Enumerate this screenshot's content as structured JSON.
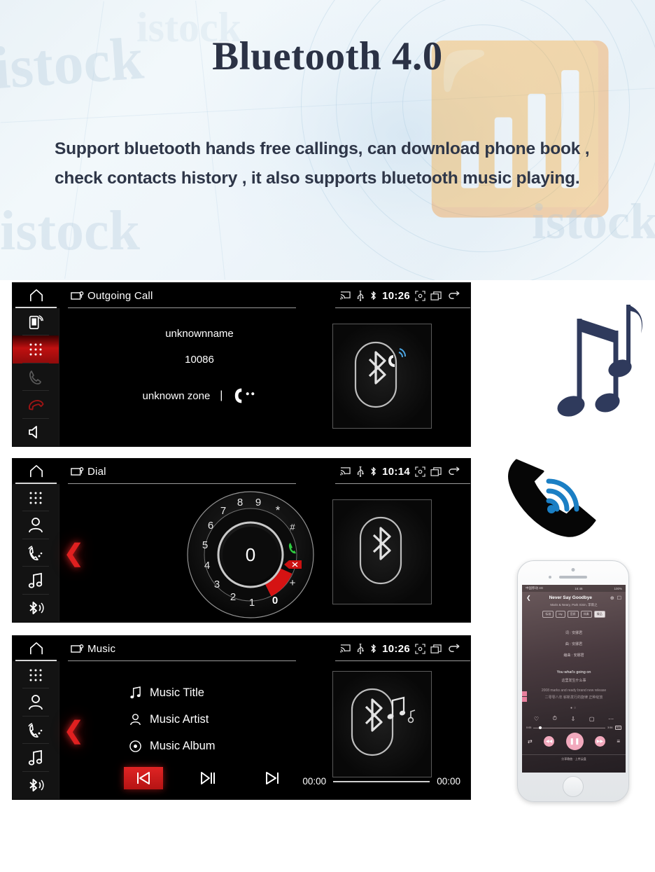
{
  "hero": {
    "title": "Bluetooth 4.0",
    "body": "Support bluetooth hands free callings, can download phone book , check contacts history , it also supports bluetooth music playing.",
    "watermark": "istock",
    "title_color": "#2b3245",
    "body_color": "#2e3648"
  },
  "accent": {
    "red": "#c01010",
    "bright_red": "#e02424",
    "status_white": "#ffffff"
  },
  "screens": [
    {
      "id": "outgoing-call",
      "home_icon": "home-icon",
      "header_icon": "display-cast-icon",
      "title": "Outgoing Call",
      "status": {
        "icons": [
          "screencast-icon",
          "usb-icon",
          "bluetooth-icon"
        ],
        "time": "10:26",
        "right_icons": [
          "fullscreen-icon",
          "recent-apps-icon",
          "back-icon"
        ]
      },
      "rail": [
        {
          "name": "phone-signal-icon",
          "active": false
        },
        {
          "name": "keypad-icon",
          "active": true
        },
        {
          "name": "call-handset-icon",
          "active": false
        },
        {
          "name": "hangup-icon",
          "active": false
        },
        {
          "name": "speaker-icon",
          "active": false
        }
      ],
      "call": {
        "name": "unknownname",
        "number": "10086",
        "zone": "unknown zone",
        "separator": "|",
        "dots_icon": "calling-handset-icon"
      },
      "art_icon": "bluetooth-call-icon"
    },
    {
      "id": "dial",
      "home_icon": "home-icon",
      "header_icon": "display-cast-icon",
      "title": "Dial",
      "status": {
        "icons": [
          "screencast-icon",
          "usb-icon",
          "bluetooth-icon"
        ],
        "time": "10:14",
        "right_icons": [
          "fullscreen-icon",
          "recent-apps-icon",
          "back-icon"
        ]
      },
      "rail": [
        {
          "name": "keypad-icon",
          "active": false
        },
        {
          "name": "contacts-icon",
          "active": false
        },
        {
          "name": "call-history-icon",
          "active": false
        },
        {
          "name": "music-icon",
          "active": false
        },
        {
          "name": "bluetooth-icon",
          "active": false
        }
      ],
      "back_chevron": "❮",
      "dial": {
        "center_display": "0",
        "ring_keys": [
          "9",
          "8",
          "7",
          "6",
          "5",
          "4",
          "3",
          "2",
          "1",
          "0",
          "+",
          "*",
          "#"
        ],
        "highlighted_key": "0",
        "call_icon": "green-call-icon",
        "delete_icon": "backspace-icon",
        "star_key": "*",
        "hash_key": "#",
        "plus_key": "+"
      },
      "art_icon": "bluetooth-icon"
    },
    {
      "id": "music",
      "home_icon": "home-icon",
      "header_icon": "display-cast-icon",
      "title": "Music",
      "status": {
        "icons": [
          "screencast-icon",
          "usb-icon",
          "bluetooth-icon"
        ],
        "time": "10:26",
        "right_icons": [
          "fullscreen-icon",
          "recent-apps-icon",
          "back-icon"
        ]
      },
      "rail": [
        {
          "name": "keypad-icon",
          "active": false
        },
        {
          "name": "contacts-icon",
          "active": false
        },
        {
          "name": "call-history-icon",
          "active": false
        },
        {
          "name": "music-icon",
          "active": false
        },
        {
          "name": "bluetooth-icon",
          "active": false
        }
      ],
      "back_chevron": "❮",
      "rows": [
        {
          "icon": "music-note-icon",
          "label": "Music Title"
        },
        {
          "icon": "artist-icon",
          "label": "Music Artist"
        },
        {
          "icon": "album-disc-icon",
          "label": "Music Album"
        }
      ],
      "transport": [
        {
          "name": "previous-track-button",
          "glyph": "⏮",
          "active": true
        },
        {
          "name": "play-pause-button",
          "glyph": "▶‖",
          "active": false
        },
        {
          "name": "next-track-button",
          "glyph": "⏭",
          "active": false
        }
      ],
      "elapsed_time": "00:00",
      "total_time": "00:00",
      "art_icon": "bluetooth-music-icon"
    }
  ],
  "decor": {
    "music_notes_icon": "music-notes-icon",
    "phone_call_icon": "phone-handset-signal-icon"
  },
  "phone_mockup": {
    "statusbar": {
      "left": "中国移动 4G",
      "center": "16:46",
      "right": "100%"
    },
    "back_icon": "chevron-left-icon",
    "song_title": "Never Say Goodbye",
    "artist_line": "Maris & Neary, Park Sinin, 李雨之",
    "chips": [
      "标准",
      "My",
      "音质",
      "伴奏",
      "臻品"
    ],
    "selected_chip": "臻品",
    "credits": [
      "词 : 安娜君",
      "曲 : 安娜君",
      "编曲 : 安娜君"
    ],
    "lyric_highlight": "You what's going on",
    "lyric_sub": "这里发生什么事",
    "lyric_next": "2008 marks and ready brand new release",
    "lyric_next_sub": "二零零八年 崭新发行的旋律 正种绽放",
    "action_icons": [
      "heart-icon",
      "add-timer-icon",
      "download-icon",
      "comment-icon",
      "more-icon"
    ],
    "elapsed": "0:05",
    "duration": "3:56",
    "quality_badge": "SQ",
    "transport_icons": [
      "shuffle-icon",
      "previous-icon",
      "pause-icon",
      "next-icon",
      "playlist-icon"
    ],
    "bottom_text": "分享歌曲 · 上传云盘"
  }
}
